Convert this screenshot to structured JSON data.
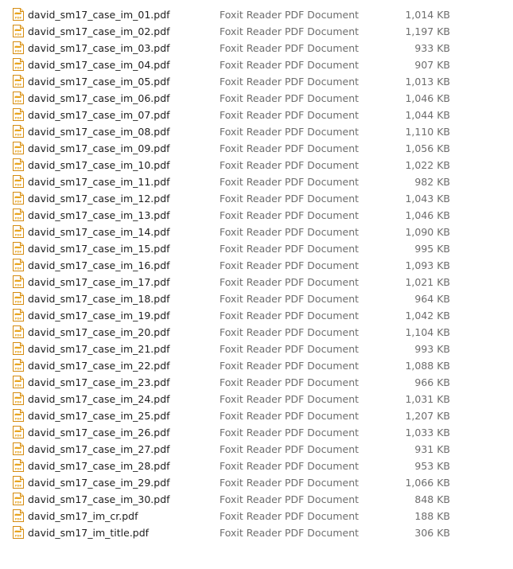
{
  "icon": "foxit-pdf-file-icon",
  "icon_label": "PDF",
  "colors": {
    "icon_orange": "#e8a21a",
    "icon_border": "#d58b10",
    "name_text": "#1e1e1e",
    "meta_text": "#6d6d6d"
  },
  "files": [
    {
      "name": "david_sm17_case_im_01.pdf",
      "type": "Foxit Reader PDF Document",
      "size": "1,014 KB"
    },
    {
      "name": "david_sm17_case_im_02.pdf",
      "type": "Foxit Reader PDF Document",
      "size": "1,197 KB"
    },
    {
      "name": "david_sm17_case_im_03.pdf",
      "type": "Foxit Reader PDF Document",
      "size": "933 KB"
    },
    {
      "name": "david_sm17_case_im_04.pdf",
      "type": "Foxit Reader PDF Document",
      "size": "907 KB"
    },
    {
      "name": "david_sm17_case_im_05.pdf",
      "type": "Foxit Reader PDF Document",
      "size": "1,013 KB"
    },
    {
      "name": "david_sm17_case_im_06.pdf",
      "type": "Foxit Reader PDF Document",
      "size": "1,046 KB"
    },
    {
      "name": "david_sm17_case_im_07.pdf",
      "type": "Foxit Reader PDF Document",
      "size": "1,044 KB"
    },
    {
      "name": "david_sm17_case_im_08.pdf",
      "type": "Foxit Reader PDF Document",
      "size": "1,110 KB"
    },
    {
      "name": "david_sm17_case_im_09.pdf",
      "type": "Foxit Reader PDF Document",
      "size": "1,056 KB"
    },
    {
      "name": "david_sm17_case_im_10.pdf",
      "type": "Foxit Reader PDF Document",
      "size": "1,022 KB"
    },
    {
      "name": "david_sm17_case_im_11.pdf",
      "type": "Foxit Reader PDF Document",
      "size": "982 KB"
    },
    {
      "name": "david_sm17_case_im_12.pdf",
      "type": "Foxit Reader PDF Document",
      "size": "1,043 KB"
    },
    {
      "name": "david_sm17_case_im_13.pdf",
      "type": "Foxit Reader PDF Document",
      "size": "1,046 KB"
    },
    {
      "name": "david_sm17_case_im_14.pdf",
      "type": "Foxit Reader PDF Document",
      "size": "1,090 KB"
    },
    {
      "name": "david_sm17_case_im_15.pdf",
      "type": "Foxit Reader PDF Document",
      "size": "995 KB"
    },
    {
      "name": "david_sm17_case_im_16.pdf",
      "type": "Foxit Reader PDF Document",
      "size": "1,093 KB"
    },
    {
      "name": "david_sm17_case_im_17.pdf",
      "type": "Foxit Reader PDF Document",
      "size": "1,021 KB"
    },
    {
      "name": "david_sm17_case_im_18.pdf",
      "type": "Foxit Reader PDF Document",
      "size": "964 KB"
    },
    {
      "name": "david_sm17_case_im_19.pdf",
      "type": "Foxit Reader PDF Document",
      "size": "1,042 KB"
    },
    {
      "name": "david_sm17_case_im_20.pdf",
      "type": "Foxit Reader PDF Document",
      "size": "1,104 KB"
    },
    {
      "name": "david_sm17_case_im_21.pdf",
      "type": "Foxit Reader PDF Document",
      "size": "993 KB"
    },
    {
      "name": "david_sm17_case_im_22.pdf",
      "type": "Foxit Reader PDF Document",
      "size": "1,088 KB"
    },
    {
      "name": "david_sm17_case_im_23.pdf",
      "type": "Foxit Reader PDF Document",
      "size": "966 KB"
    },
    {
      "name": "david_sm17_case_im_24.pdf",
      "type": "Foxit Reader PDF Document",
      "size": "1,031 KB"
    },
    {
      "name": "david_sm17_case_im_25.pdf",
      "type": "Foxit Reader PDF Document",
      "size": "1,207 KB"
    },
    {
      "name": "david_sm17_case_im_26.pdf",
      "type": "Foxit Reader PDF Document",
      "size": "1,033 KB"
    },
    {
      "name": "david_sm17_case_im_27.pdf",
      "type": "Foxit Reader PDF Document",
      "size": "931 KB"
    },
    {
      "name": "david_sm17_case_im_28.pdf",
      "type": "Foxit Reader PDF Document",
      "size": "953 KB"
    },
    {
      "name": "david_sm17_case_im_29.pdf",
      "type": "Foxit Reader PDF Document",
      "size": "1,066 KB"
    },
    {
      "name": "david_sm17_case_im_30.pdf",
      "type": "Foxit Reader PDF Document",
      "size": "848 KB"
    },
    {
      "name": "david_sm17_im_cr.pdf",
      "type": "Foxit Reader PDF Document",
      "size": "188 KB"
    },
    {
      "name": "david_sm17_im_title.pdf",
      "type": "Foxit Reader PDF Document",
      "size": "306 KB"
    }
  ]
}
